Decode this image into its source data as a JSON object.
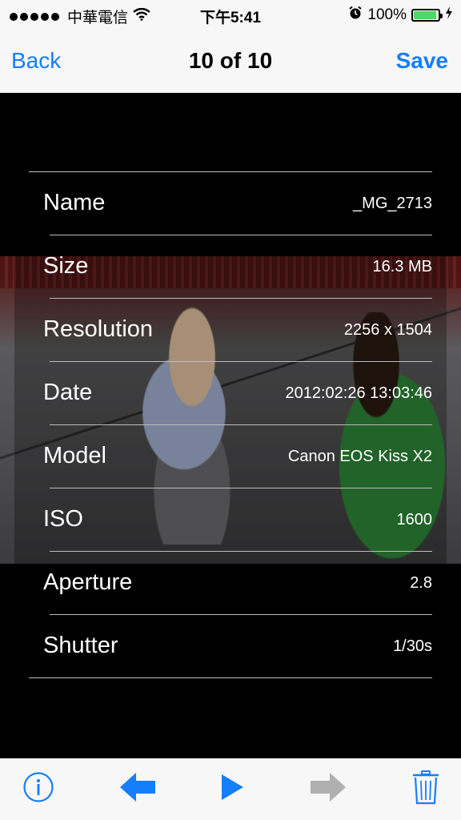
{
  "status_bar": {
    "carrier": "中華電信",
    "time": "下午5:41",
    "battery": "100%",
    "signal_icon": "signal-dots-icon",
    "wifi_icon": "wifi-icon",
    "alarm_icon": "alarm-icon",
    "battery_icon": "battery-icon",
    "charging_icon": "charging-bolt-icon"
  },
  "nav": {
    "back_label": "Back",
    "title": "10 of 10",
    "save_label": "Save"
  },
  "info": {
    "rows": [
      {
        "label": "Name",
        "value": "_MG_2713"
      },
      {
        "label": "Size",
        "value": "16.3 MB"
      },
      {
        "label": "Resolution",
        "value": "2256 x 1504"
      },
      {
        "label": "Date",
        "value": "2012:02:26 13:03:46"
      },
      {
        "label": "Model",
        "value": "Canon EOS Kiss X2"
      },
      {
        "label": "ISO",
        "value": "1600"
      },
      {
        "label": "Aperture",
        "value": "2.8"
      },
      {
        "label": "Shutter",
        "value": "1/30s"
      }
    ]
  },
  "toolbar": {
    "info_icon": "info-icon",
    "prev_icon": "arrow-left-icon",
    "play_icon": "play-icon",
    "next_icon": "arrow-right-icon",
    "trash_icon": "trash-icon"
  },
  "colors": {
    "accent": "#157efb",
    "bar_bg": "#f7f7f7",
    "battery_fill": "#4cd964",
    "disabled": "#b0b0b0"
  }
}
